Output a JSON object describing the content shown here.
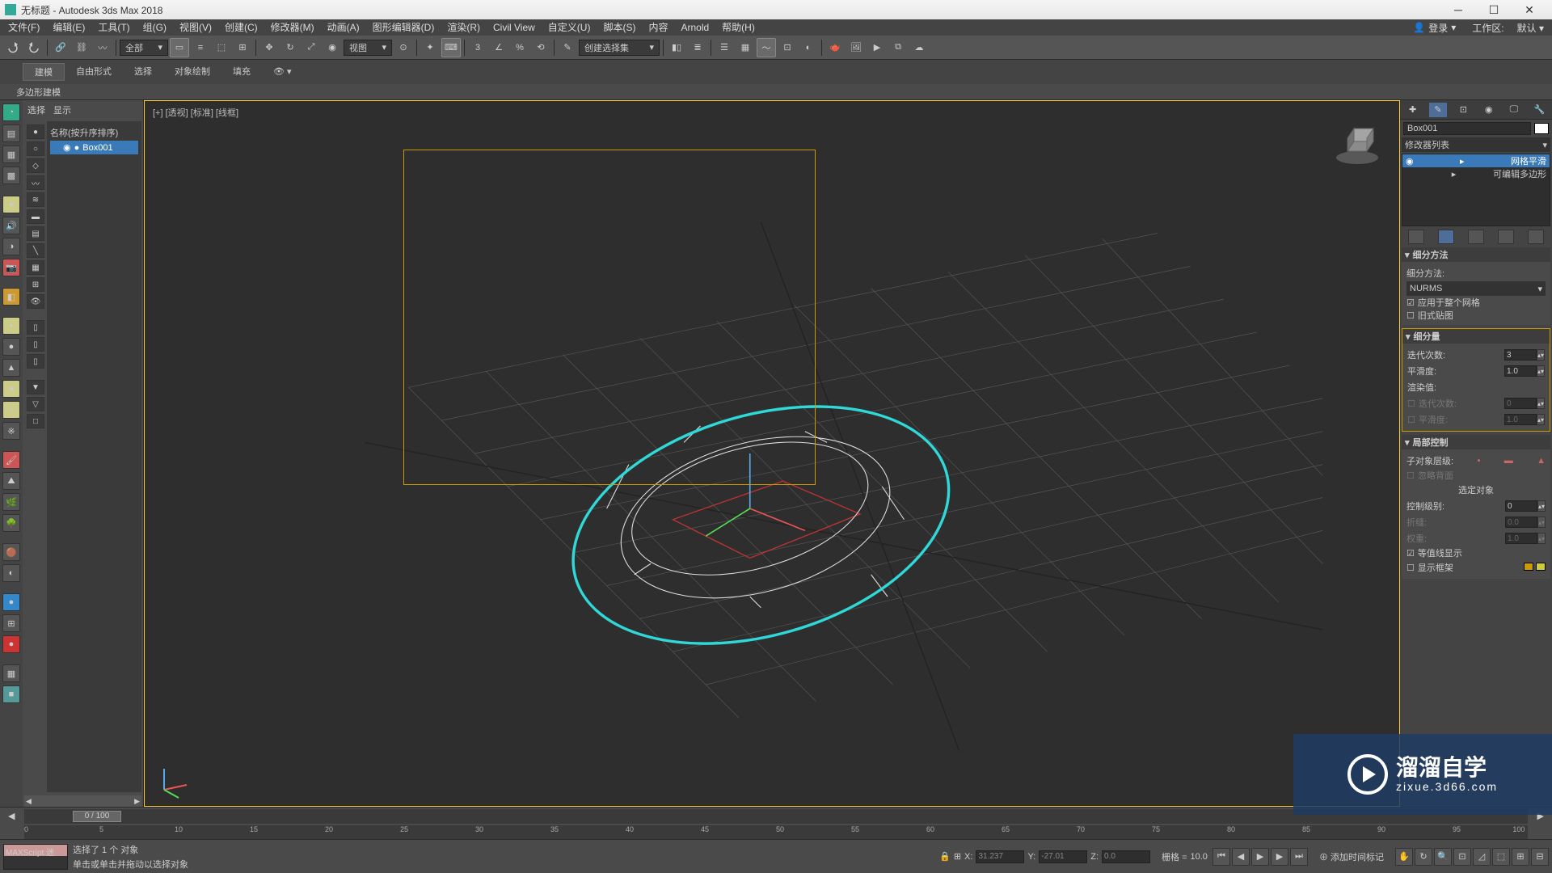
{
  "title": "无标题 - Autodesk 3ds Max 2018",
  "menus": [
    "文件(F)",
    "编辑(E)",
    "工具(T)",
    "组(G)",
    "视图(V)",
    "创建(C)",
    "修改器(M)",
    "动画(A)",
    "图形编辑器(D)",
    "渲染(R)",
    "Civil View",
    "自定义(U)",
    "脚本(S)",
    "内容",
    "Arnold",
    "帮助(H)"
  ],
  "signin": "登录",
  "workspace_label": "工作区:",
  "workspace_value": "默认",
  "maintool": {
    "filter": "全部",
    "view": "视图",
    "selset": "创建选择集"
  },
  "ribbon": {
    "tabs": [
      "建模",
      "自由形式",
      "选择",
      "对象绘制",
      "填充"
    ],
    "sub": "多边形建模"
  },
  "scene": {
    "tabs": [
      "选择",
      "显示"
    ],
    "header": "名称(按升序排序)",
    "item": "Box001"
  },
  "viewport": {
    "label": "[+] [透视] [标准] [线框]"
  },
  "panel": {
    "object_name": "Box001",
    "modlist_label": "修改器列表",
    "stack": [
      "网格平滑",
      "可编辑多边形"
    ],
    "rollouts": {
      "subdiv_method": {
        "title": "细分方法",
        "label": "细分方法:",
        "value": "NURMS",
        "apply": "应用于整个网格",
        "old": "旧式贴图"
      },
      "subdiv_amount": {
        "title": "细分量",
        "iter_label": "迭代次数:",
        "iter": "3",
        "smooth_label": "平滑度:",
        "smooth": "1.0",
        "rend": "渲染值:",
        "r_iter": "0",
        "r_smooth": "1.0"
      },
      "local": {
        "title": "局部控制",
        "sublevel": "子对象层级:",
        "ignore": "忽略背面",
        "selobj": "选定对象",
        "ctrl_level_label": "控制级别:",
        "ctrl_level": "0",
        "crease_label": "折缝:",
        "crease": "0.0",
        "weight_label": "权重:",
        "weight": "1.0",
        "iso": "等值线显示",
        "showcage": "显示框架"
      }
    }
  },
  "timeline": {
    "frame": "0 / 100",
    "ticks": [
      0,
      5,
      10,
      15,
      20,
      25,
      30,
      35,
      40,
      45,
      50,
      55,
      60,
      65,
      70,
      75,
      80,
      85,
      90,
      95,
      100
    ]
  },
  "status": {
    "maxscript": "MAXScript 迷",
    "line1": "选择了 1 个 对象",
    "line2": "单击或单击并拖动以选择对象",
    "x": "31.237",
    "y": "-27.01",
    "z": "0.0",
    "grid_label": "栅格 =",
    "grid": "10.0",
    "addtime": "添加时间标记"
  },
  "watermark": {
    "brand": "溜溜自学",
    "url": "zixue.3d66.com"
  }
}
